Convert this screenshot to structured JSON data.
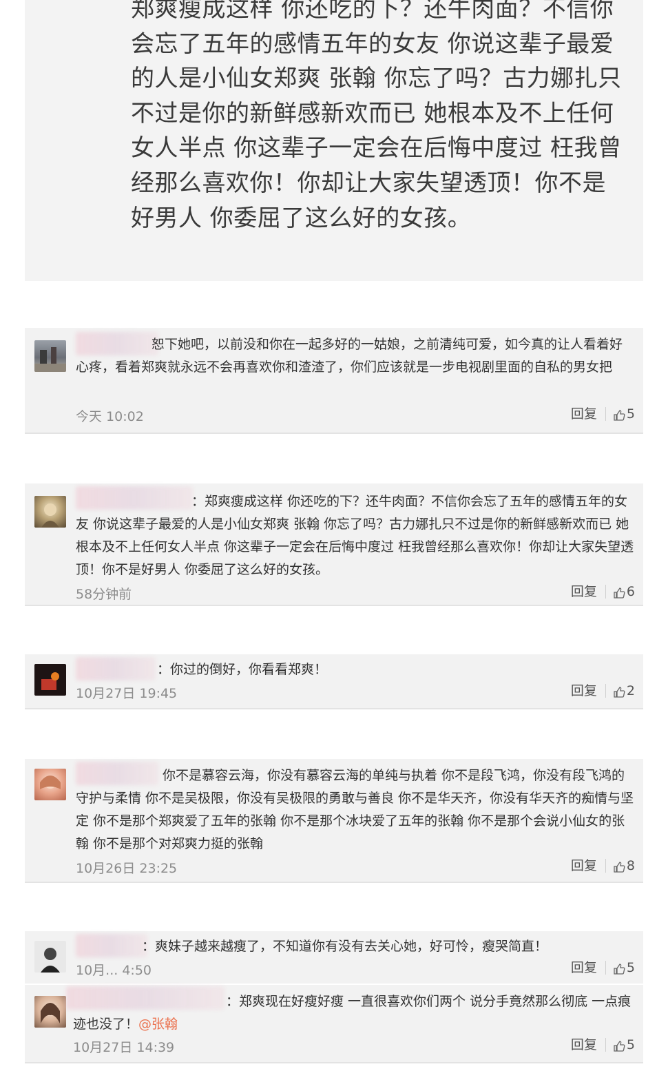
{
  "top_quote": {
    "text": "郑爽瘦成这样 你还吃的下？还牛肉面？不信你会忘了五年的感情五年的女友 你说这辈子最爱的人是小仙女郑爽 张翰 你忘了吗？古力娜扎只不过是你的新鲜感新欢而已 她根本及不上任何女人半点 你这辈子一定会在后悔中度过 枉我曾经那么喜欢你！你却让大家失望透顶！你不是好男人 你委屈了这么好的女孩。"
  },
  "comments": [
    {
      "lead": "恕下她吧，",
      "text": "以前没和你在一起多好的一姑娘，之前清纯可爱，如今真的让人看着好心疼，看着郑爽就永远不会再喜欢你和渣渣了，你们应该就是一步电视剧里面的自私的男女把",
      "time": "今天 10:02",
      "reply": "回复",
      "likes": "5"
    },
    {
      "lead": "：",
      "text": "郑爽瘦成这样 你还吃的下？还牛肉面？不信你会忘了五年的感情五年的女友 你说这辈子最爱的人是小仙女郑爽 张翰 你忘了吗？古力娜扎只不过是你的新鲜感新欢而已 她根本及不上任何女人半点 你这辈子一定会在后悔中度过 枉我曾经那么喜欢你！你却让大家失望透顶！你不是好男人 你委屈了这么好的女孩。",
      "time": "58分钟前",
      "reply": "回复",
      "likes": "6"
    },
    {
      "lead": "：",
      "text": "你过的倒好，你看看郑爽！",
      "time": "10月27日 19:45",
      "reply": "回复",
      "likes": "2"
    },
    {
      "lead": "",
      "text": "你不是慕容云海，你没有慕容云海的单纯与执着 你不是段飞鸿，你没有段飞鸿的守护与柔情 你不是吴极限，你没有吴极限的勇敢与善良 你不是华天齐，你没有华天齐的痴情与坚定 你不是那个郑爽爱了五年的张翰 你不是那个冰块爱了五年的张翰 你不是那个会说小仙女的张翰 你不是那个对郑爽力挺的张翰",
      "time": "10月26日 23:25",
      "reply": "回复",
      "likes": "8"
    },
    {
      "lead": "：",
      "text": "爽妹子越来越瘦了，不知道你有没有去关心她，好可怜，瘦哭简直！",
      "time": "10月... 4:50",
      "reply": "回复",
      "likes": "5"
    },
    {
      "lead": "：",
      "text": "郑爽现在好瘦好瘦 一直很喜欢你们两个 说分手竟然那么彻底 一点痕迹也没了！",
      "mention": "@张翰",
      "time": "10月27日 14:39",
      "reply": "回复",
      "likes": "5"
    }
  ],
  "colors": {
    "card_bg": "#f2f2f2",
    "mention": "#eb7350",
    "time": "#8c8c8c"
  },
  "icons": [
    "thumbs-up-icon",
    "avatar"
  ]
}
